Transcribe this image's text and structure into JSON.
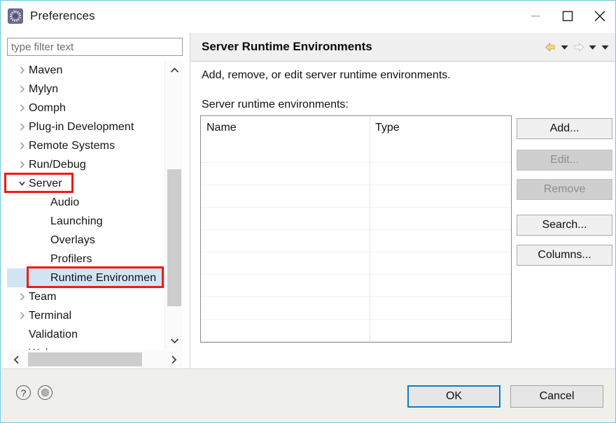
{
  "window": {
    "title": "Preferences",
    "icon": "preferences-gear-icon",
    "border_color": "#6fc6e0",
    "controls": {
      "minimize": "minimize-icon",
      "maximize": "maximize-icon",
      "close": "close-icon"
    }
  },
  "left_pane": {
    "filter": {
      "placeholder": "type filter text",
      "value": ""
    },
    "tree": [
      {
        "label": "Maven",
        "depth": 1,
        "state": "collapsed",
        "selected": false
      },
      {
        "label": "Mylyn",
        "depth": 1,
        "state": "collapsed",
        "selected": false
      },
      {
        "label": "Oomph",
        "depth": 1,
        "state": "collapsed",
        "selected": false
      },
      {
        "label": "Plug-in Development",
        "depth": 1,
        "state": "collapsed",
        "selected": false
      },
      {
        "label": "Remote Systems",
        "depth": 1,
        "state": "collapsed",
        "selected": false
      },
      {
        "label": "Run/Debug",
        "depth": 1,
        "state": "collapsed",
        "selected": false
      },
      {
        "label": "Server",
        "depth": 1,
        "state": "expanded",
        "selected": false
      },
      {
        "label": "Audio",
        "depth": 2,
        "state": "leaf",
        "selected": false
      },
      {
        "label": "Launching",
        "depth": 2,
        "state": "leaf",
        "selected": false
      },
      {
        "label": "Overlays",
        "depth": 2,
        "state": "leaf",
        "selected": false
      },
      {
        "label": "Profilers",
        "depth": 2,
        "state": "leaf",
        "selected": false
      },
      {
        "label": "Runtime Environmen",
        "depth": 2,
        "state": "leaf",
        "selected": true
      },
      {
        "label": "Team",
        "depth": 1,
        "state": "collapsed",
        "selected": false
      },
      {
        "label": "Terminal",
        "depth": 1,
        "state": "collapsed",
        "selected": false
      },
      {
        "label": "Validation",
        "depth": 1,
        "state": "leaf",
        "selected": false
      },
      {
        "label": "Web",
        "depth": 1,
        "state": "collapsed",
        "selected": false
      }
    ],
    "annotations": [
      {
        "name": "server-highlight",
        "color": "#ef1b16",
        "target": "Server"
      },
      {
        "name": "runtime-highlight",
        "color": "#ef1b16",
        "target": "Runtime Environmen"
      }
    ],
    "selection_color": "#d3e4f3"
  },
  "right_pane": {
    "title": "Server Runtime Environments",
    "description": "Add, remove, or edit server runtime environments.",
    "table_label": "Server runtime environments:",
    "nav": {
      "back": "back-arrow-icon",
      "back_menu": "back-dropdown-icon",
      "forward": "forward-arrow-icon",
      "forward_menu": "forward-dropdown-icon",
      "menu": "view-menu-icon"
    },
    "table": {
      "columns": [
        "Name",
        "Type"
      ],
      "rows": []
    },
    "buttons": [
      {
        "label": "Add...",
        "enabled": true
      },
      {
        "label": "Edit...",
        "enabled": false
      },
      {
        "label": "Remove",
        "enabled": false
      },
      {
        "label": "Search...",
        "enabled": true
      },
      {
        "label": "Columns...",
        "enabled": true
      }
    ]
  },
  "footer": {
    "help_icon": "help-icon",
    "apply_icon": "apply-settings-icon",
    "ok_label": "OK",
    "cancel_label": "Cancel",
    "focus_color": "#0a7bd0"
  }
}
